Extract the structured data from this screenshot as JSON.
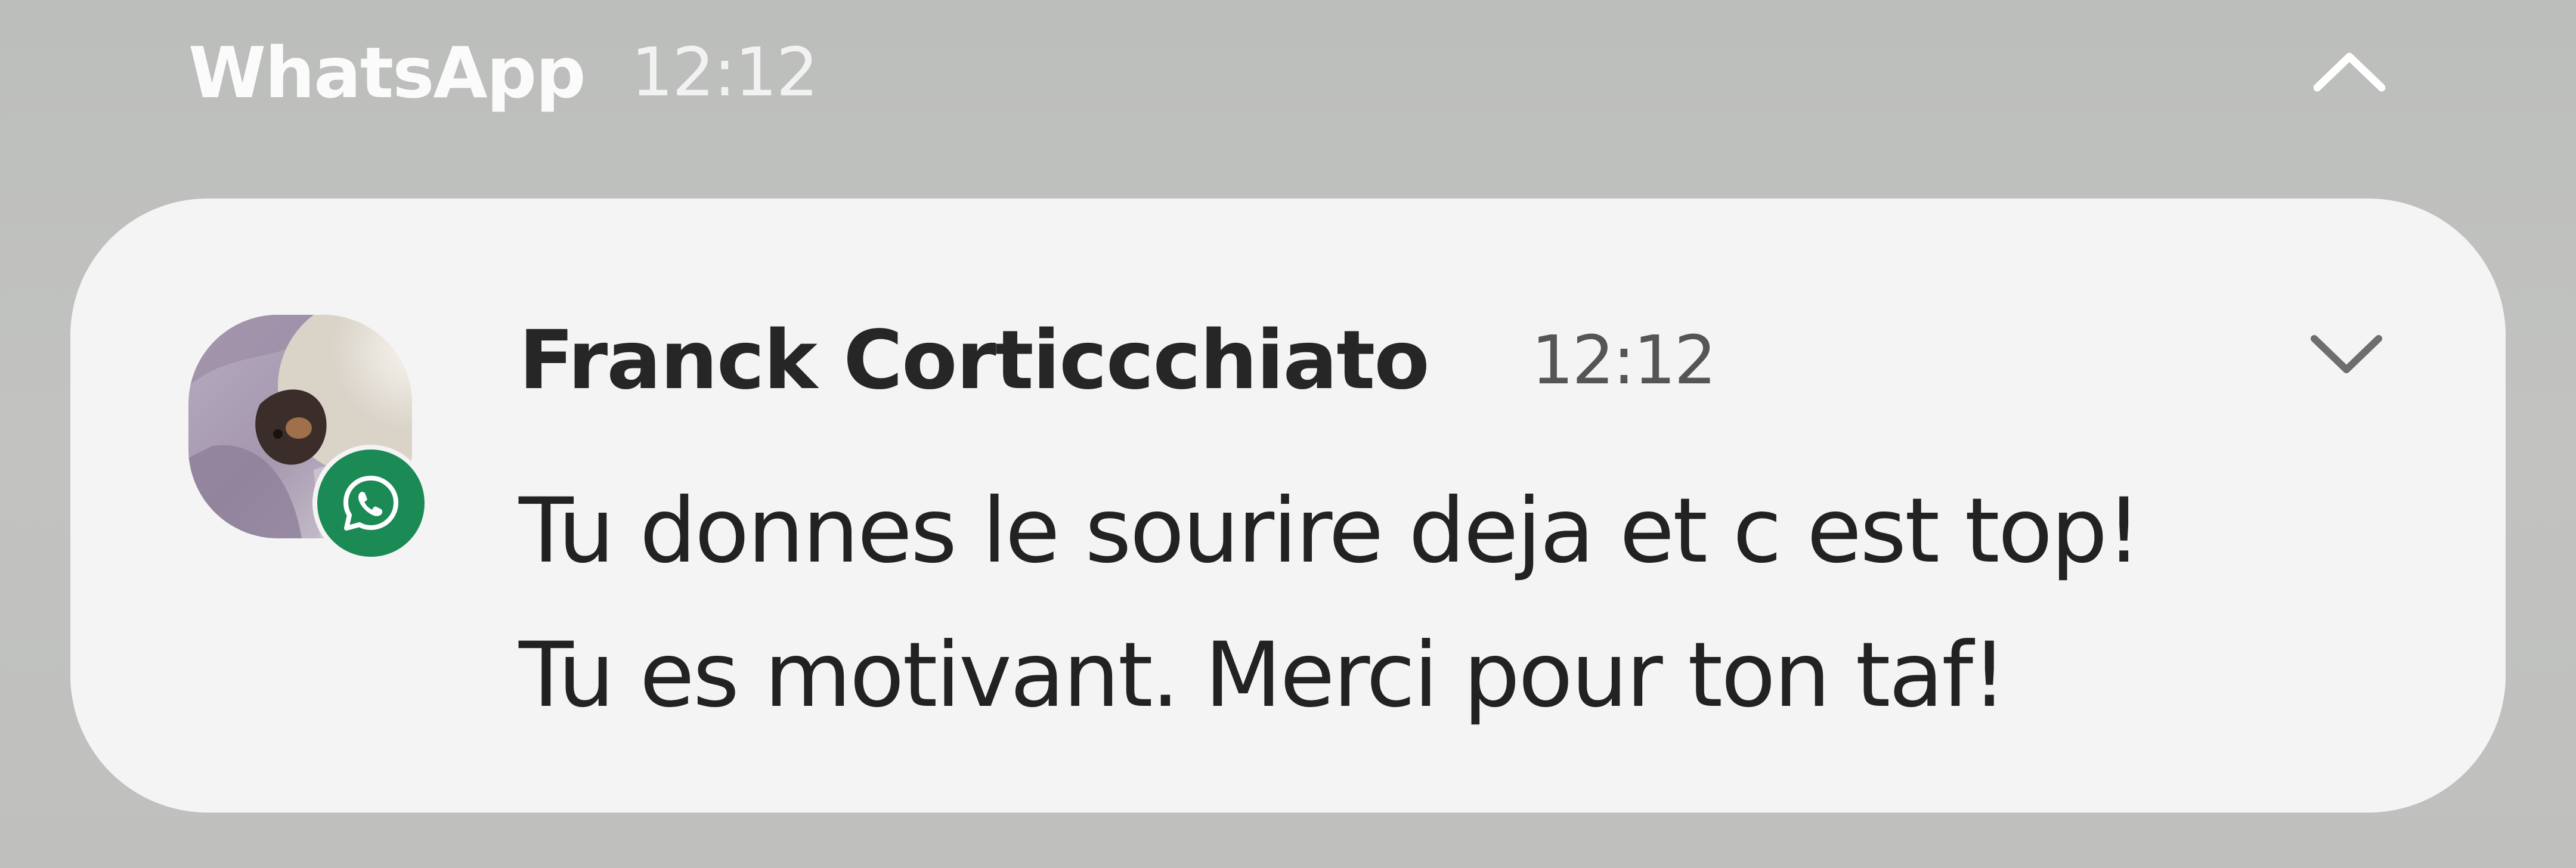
{
  "group": {
    "app_name": "WhatsApp",
    "time": "12:12",
    "collapse_icon": "chevron-up-icon"
  },
  "notification": {
    "sender": "Franck Corticcchiato",
    "time": "12:12",
    "message_lines": [
      "Tu donnes le sourire deja et c est top!",
      "Tu es motivant. Merci pour ton taf!"
    ],
    "expand_icon": "chevron-down-icon",
    "avatar_icon": "contact-photo",
    "badge_icon": "whatsapp-icon"
  },
  "colors": {
    "background": "#bfc0be",
    "card": "#f4f4f4",
    "whatsapp_green": "#1b8a55",
    "header_text": "#fbfbfb",
    "sender_text": "#262626",
    "time_text": "#555555",
    "message_text": "#222222"
  }
}
